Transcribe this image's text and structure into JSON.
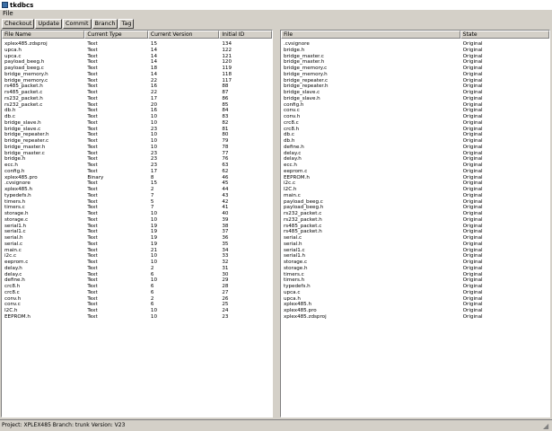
{
  "window": {
    "title": "tkdbcs"
  },
  "menu": {
    "file_label": "File"
  },
  "toolbar": {
    "checkout": "Checkout",
    "update": "Update",
    "commit": "Commit",
    "branch": "Branch",
    "tag": "Tag"
  },
  "left_table": {
    "headers": [
      "File Name",
      "Current Type",
      "Current Version",
      "Initial ID"
    ],
    "rows": [
      [
        "xplex485.zdsproj",
        "Text",
        "15",
        "134"
      ],
      [
        "upca.h",
        "Text",
        "14",
        "122"
      ],
      [
        "upca.c",
        "Text",
        "14",
        "121"
      ],
      [
        "payload_beeg.h",
        "Text",
        "14",
        "120"
      ],
      [
        "payload_beeg.c",
        "Text",
        "18",
        "119"
      ],
      [
        "bridge_memory.h",
        "Text",
        "14",
        "118"
      ],
      [
        "bridge_memory.c",
        "Text",
        "22",
        "117"
      ],
      [
        "rs485_packet.h",
        "Text",
        "16",
        "88"
      ],
      [
        "rs485_packet.c",
        "Text",
        "22",
        "87"
      ],
      [
        "rs232_packet.h",
        "Text",
        "17",
        "86"
      ],
      [
        "rs232_packet.c",
        "Text",
        "20",
        "85"
      ],
      [
        "db.h",
        "Text",
        "16",
        "84"
      ],
      [
        "db.c",
        "Text",
        "10",
        "83"
      ],
      [
        "bridge_slave.h",
        "Text",
        "10",
        "82"
      ],
      [
        "bridge_slave.c",
        "Text",
        "23",
        "81"
      ],
      [
        "bridge_repeater.h",
        "Text",
        "10",
        "80"
      ],
      [
        "bridge_repeater.c",
        "Text",
        "10",
        "79"
      ],
      [
        "bridge_master.h",
        "Text",
        "10",
        "78"
      ],
      [
        "bridge_master.c",
        "Text",
        "23",
        "77"
      ],
      [
        "bridge.h",
        "Text",
        "23",
        "76"
      ],
      [
        "ecc.h",
        "Text",
        "23",
        "63"
      ],
      [
        "config.h",
        "Text",
        "17",
        "62"
      ],
      [
        "xplex485.pro",
        "Binary",
        "8",
        "46"
      ],
      [
        ".cvsignore",
        "Text",
        "15",
        "45"
      ],
      [
        "xplex485.h",
        "Text",
        "2",
        "44"
      ],
      [
        "typedefs.h",
        "Text",
        "7",
        "43"
      ],
      [
        "timers.h",
        "Text",
        "5",
        "42"
      ],
      [
        "timers.c",
        "Text",
        "7",
        "41"
      ],
      [
        "storage.h",
        "Text",
        "10",
        "40"
      ],
      [
        "storage.c",
        "Text",
        "10",
        "39"
      ],
      [
        "serial1.h",
        "Text",
        "19",
        "38"
      ],
      [
        "serial1.c",
        "Text",
        "19",
        "37"
      ],
      [
        "serial.h",
        "Text",
        "19",
        "36"
      ],
      [
        "serial.c",
        "Text",
        "19",
        "35"
      ],
      [
        "main.c",
        "Text",
        "21",
        "34"
      ],
      [
        "i2c.c",
        "Text",
        "10",
        "33"
      ],
      [
        "eeprom.c",
        "Text",
        "10",
        "32"
      ],
      [
        "delay.h",
        "Text",
        "2",
        "31"
      ],
      [
        "delay.c",
        "Text",
        "6",
        "30"
      ],
      [
        "define.h",
        "Text",
        "10",
        "29"
      ],
      [
        "crc8.h",
        "Text",
        "6",
        "28"
      ],
      [
        "crc8.c",
        "Text",
        "6",
        "27"
      ],
      [
        "conv.h",
        "Text",
        "2",
        "26"
      ],
      [
        "conv.c",
        "Text",
        "6",
        "25"
      ],
      [
        "I2C.h",
        "Text",
        "10",
        "24"
      ],
      [
        "EEPROM.h",
        "Text",
        "10",
        "23"
      ]
    ]
  },
  "right_table": {
    "headers": [
      "File",
      "State"
    ],
    "rows": [
      [
        ".cvsignore",
        "Original"
      ],
      [
        "bridge.h",
        "Original"
      ],
      [
        "bridge_master.c",
        "Original"
      ],
      [
        "bridge_master.h",
        "Original"
      ],
      [
        "bridge_memory.c",
        "Original"
      ],
      [
        "bridge_memory.h",
        "Original"
      ],
      [
        "bridge_repeater.c",
        "Original"
      ],
      [
        "bridge_repeater.h",
        "Original"
      ],
      [
        "bridge_slave.c",
        "Original"
      ],
      [
        "bridge_slave.h",
        "Original"
      ],
      [
        "config.h",
        "Original"
      ],
      [
        "conv.c",
        "Original"
      ],
      [
        "conv.h",
        "Original"
      ],
      [
        "crc8.c",
        "Original"
      ],
      [
        "crc8.h",
        "Original"
      ],
      [
        "db.c",
        "Original"
      ],
      [
        "db.h",
        "Original"
      ],
      [
        "define.h",
        "Original"
      ],
      [
        "delay.c",
        "Original"
      ],
      [
        "delay.h",
        "Original"
      ],
      [
        "ecc.h",
        "Original"
      ],
      [
        "eeprom.c",
        "Original"
      ],
      [
        "EEPROM.h",
        "Original"
      ],
      [
        "i2c.c",
        "Original"
      ],
      [
        "I2C.h",
        "Original"
      ],
      [
        "main.c",
        "Original"
      ],
      [
        "payload_beeg.c",
        "Original"
      ],
      [
        "payload_beeg.h",
        "Original"
      ],
      [
        "rs232_packet.c",
        "Original"
      ],
      [
        "rs232_packet.h",
        "Original"
      ],
      [
        "rs485_packet.c",
        "Original"
      ],
      [
        "rs485_packet.h",
        "Original"
      ],
      [
        "serial.c",
        "Original"
      ],
      [
        "serial.h",
        "Original"
      ],
      [
        "serial1.c",
        "Original"
      ],
      [
        "serial1.h",
        "Original"
      ],
      [
        "storage.c",
        "Original"
      ],
      [
        "storage.h",
        "Original"
      ],
      [
        "timers.c",
        "Original"
      ],
      [
        "timers.h",
        "Original"
      ],
      [
        "typedefs.h",
        "Original"
      ],
      [
        "upca.c",
        "Original"
      ],
      [
        "upca.h",
        "Original"
      ],
      [
        "xplex485.h",
        "Original"
      ],
      [
        "xplex485.pro",
        "Original"
      ],
      [
        "xplex485.zdsproj",
        "Original"
      ]
    ]
  },
  "status": {
    "text": "Project: XPLEX485 Branch: trunk Version: V23"
  }
}
